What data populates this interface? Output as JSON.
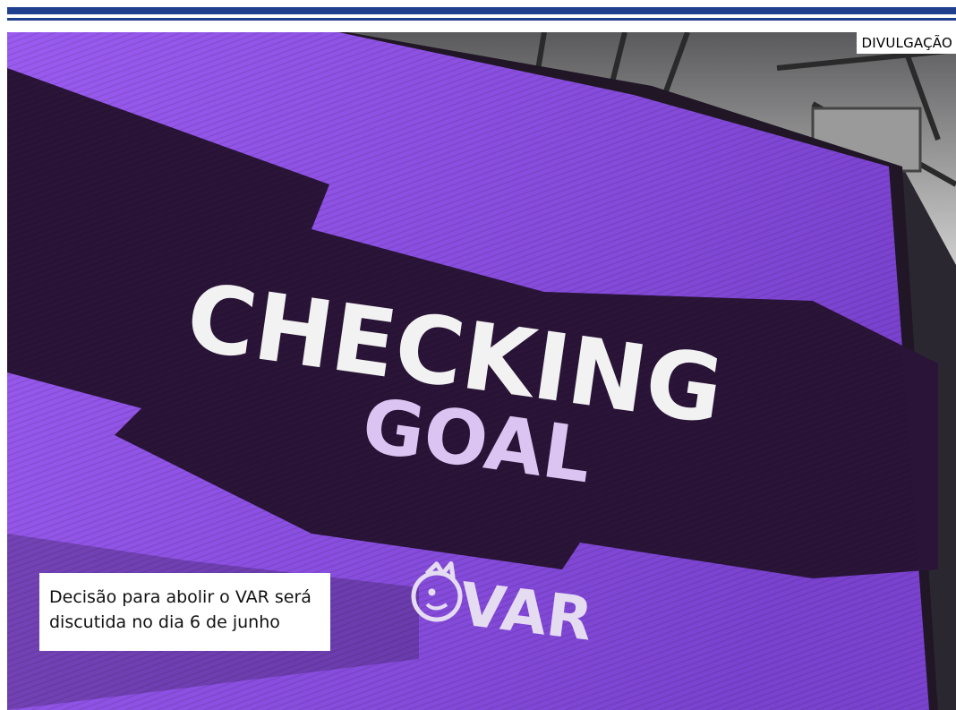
{
  "photo": {
    "credit": "DIVULGAÇÃO",
    "screen_text": {
      "line1": "CHECKING",
      "line2": "GOAL",
      "logo": "VAR"
    },
    "caption": {
      "line1": "Decisão para abolir o VAR será",
      "line2": "discutida no dia 6 de junho"
    }
  },
  "colors": {
    "header_rule": "#1f3f8f",
    "screen_purple": "#8a4fe0",
    "screen_dark": "#2a1438",
    "text_white": "#f2f2f2",
    "text_lilac": "#dcc4f2"
  }
}
